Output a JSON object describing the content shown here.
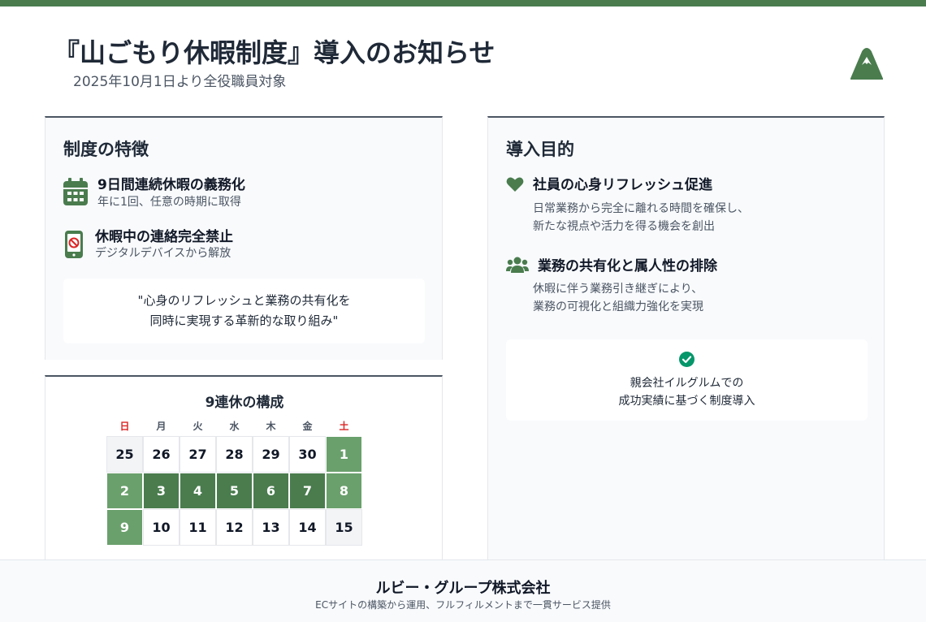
{
  "header": {
    "title": "『山ごもり休暇制度』導入のお知らせ",
    "subtitle": "2025年10月1日より全役職員対象",
    "logo_icon": "mountain-icon"
  },
  "features": {
    "heading": "制度の特徴",
    "items": [
      {
        "icon": "calendar-icon",
        "title": "9日間連続休暇の義務化",
        "sub": "年に1回、任意の時期に取得"
      },
      {
        "icon": "no-phone-icon",
        "title": "休暇中の連絡完全禁止",
        "sub": "デジタルデバイスから解放"
      }
    ],
    "quote_lines": [
      "\"心身のリフレッシュと業務の共有化を",
      "同時に実現する革新的な取り組み\""
    ]
  },
  "calendar": {
    "heading": "9連休の構成",
    "weekdays": [
      "日",
      "月",
      "火",
      "水",
      "木",
      "金",
      "土"
    ],
    "weeks": [
      [
        {
          "d": "25",
          "s": "gray"
        },
        {
          "d": "26",
          "s": "plain"
        },
        {
          "d": "27",
          "s": "plain"
        },
        {
          "d": "28",
          "s": "plain"
        },
        {
          "d": "29",
          "s": "plain"
        },
        {
          "d": "30",
          "s": "plain"
        },
        {
          "d": "1",
          "s": "light"
        }
      ],
      [
        {
          "d": "2",
          "s": "light"
        },
        {
          "d": "3",
          "s": "dark"
        },
        {
          "d": "4",
          "s": "dark"
        },
        {
          "d": "5",
          "s": "dark"
        },
        {
          "d": "6",
          "s": "dark"
        },
        {
          "d": "7",
          "s": "dark"
        },
        {
          "d": "8",
          "s": "light"
        }
      ],
      [
        {
          "d": "9",
          "s": "light"
        },
        {
          "d": "10",
          "s": "plain"
        },
        {
          "d": "11",
          "s": "plain"
        },
        {
          "d": "12",
          "s": "plain"
        },
        {
          "d": "13",
          "s": "plain"
        },
        {
          "d": "14",
          "s": "plain"
        },
        {
          "d": "15",
          "s": "gray"
        }
      ]
    ]
  },
  "purpose": {
    "heading": "導入目的",
    "items": [
      {
        "icon": "heart-icon",
        "title": "社員の心身リフレッシュ促進",
        "desc_lines": [
          "日常業務から完全に離れる時間を確保し、",
          "新たな視点や活力を得る機会を創出"
        ]
      },
      {
        "icon": "users-icon",
        "title": "業務の共有化と属人性の排除",
        "desc_lines": [
          "休暇に伴う業務引き継ぎにより、",
          "業務の可視化と組織力強化を実現"
        ]
      }
    ],
    "success_icon": "check-circle-icon",
    "success_lines": [
      "親会社イルグルムでの",
      "成功実績に基づく制度導入"
    ]
  },
  "footer": {
    "company": "ルビー・グループ株式会社",
    "description": "ECサイトの構築から運用、フルフィルメントまで一貫サービス提供"
  },
  "colors": {
    "accent": "#4a7c4e",
    "accent_light": "#6aa06c",
    "sunday_red": "#dc2626",
    "check_green": "#059669"
  }
}
